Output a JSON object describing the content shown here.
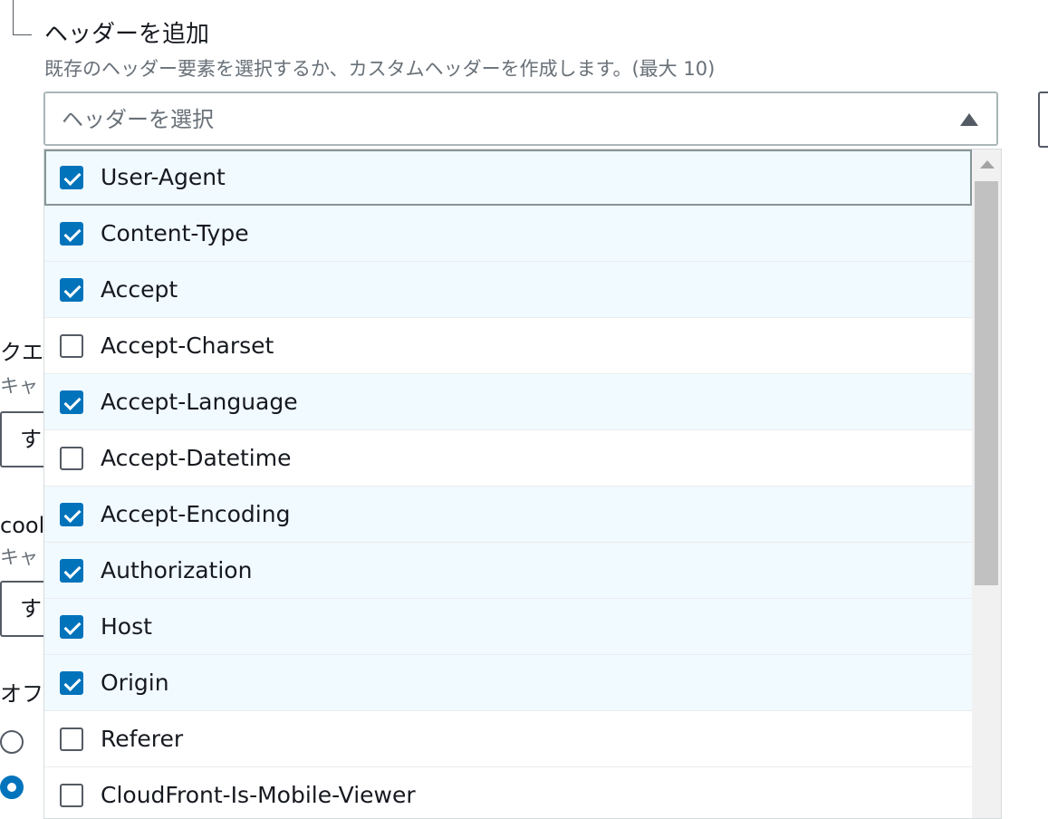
{
  "section": {
    "title": "ヘッダーを追加",
    "description": "既存のヘッダー要素を選択するか、カスタムヘッダーを作成します。(最大 10)"
  },
  "select": {
    "placeholder": "ヘッダーを選択",
    "expanded": true
  },
  "background": {
    "query_label": "クエ",
    "query_desc": "キャ",
    "query_input": "す",
    "cookie_label": "cool",
    "cookie_desc": "キャ",
    "cookie_input": "す",
    "options_label": "オフ",
    "radio1_label": "l",
    "radio2_label": "(",
    "radio1_selected": false,
    "radio2_selected": true
  },
  "options": [
    {
      "label": "User-Agent",
      "checked": true
    },
    {
      "label": "Content-Type",
      "checked": true
    },
    {
      "label": "Accept",
      "checked": true
    },
    {
      "label": "Accept-Charset",
      "checked": false
    },
    {
      "label": "Accept-Language",
      "checked": true
    },
    {
      "label": "Accept-Datetime",
      "checked": false
    },
    {
      "label": "Accept-Encoding",
      "checked": true
    },
    {
      "label": "Authorization",
      "checked": true
    },
    {
      "label": "Host",
      "checked": true
    },
    {
      "label": "Origin",
      "checked": true
    },
    {
      "label": "Referer",
      "checked": false
    },
    {
      "label": "CloudFront-Is-Mobile-Viewer",
      "checked": false
    }
  ],
  "colors": {
    "accent": "#0073bb",
    "checked_row_bg": "#f1faff",
    "muted_text": "#687078"
  }
}
